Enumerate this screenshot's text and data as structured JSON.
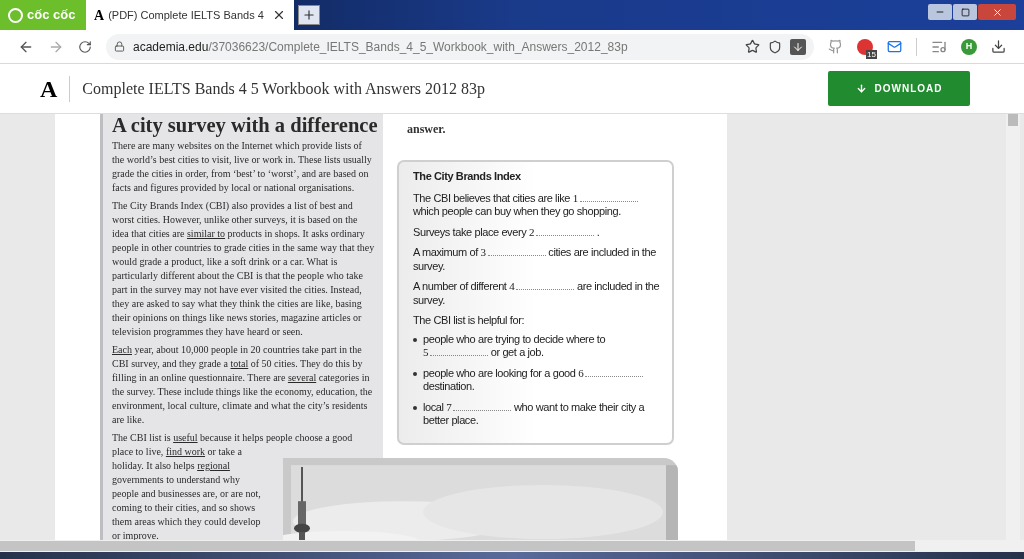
{
  "browser": {
    "brand": "cốc cốc",
    "tabs": [
      {
        "favicon": "A",
        "title": "(PDF) Complete IELTS Bands 4",
        "selected": true
      }
    ],
    "url_domain": "academia.edu",
    "url_path": "/37036623/Complete_IELTS_Bands_4_5_Workbook_with_Answers_2012_83p",
    "extension_badge": "15",
    "profile_initial": "H"
  },
  "header": {
    "logo": "A",
    "title": "Complete IELTS Bands 4 5 Workbook with Answers 2012 83p",
    "download": "DOWNLOAD"
  },
  "article": {
    "title": "A city survey with a difference",
    "paragraphs": [
      [
        {
          "text": "There are many websites on the Internet which provide lists of the world’s best cities to visit, live or work in. These lists usually grade the cities in order, from ‘best’ to ‘worst’, and are based on facts and figures provided by local or national organisations.",
          "underline": false
        }
      ],
      [
        {
          "text": "The City Brands Index (CBI) also provides a list of best and worst cities. However, unlike other surveys, it is based on the idea that cities are ",
          "underline": false
        },
        {
          "text": "similar to",
          "underline": true
        },
        {
          "text": " products in shops. It asks ordinary people in other countries to grade cities in the same way that they would grade a product, like a soft drink or a car. What is particularly different about the CBI is that the people who take part in the survey may not have ever visited the cities. Instead, they are asked to say what they think the cities are like, basing their opinions on things like news stories, magazine articles or television programmes they have heard or seen.",
          "underline": false
        }
      ],
      [
        {
          "text": "Each",
          "underline": true
        },
        {
          "text": " year, about 10,000 people in 20 countries take part in the CBI survey, and they grade a ",
          "underline": false
        },
        {
          "text": "total",
          "underline": true
        },
        {
          "text": " of 50 cities. They do this by filling in an online questionnaire. There are ",
          "underline": false
        },
        {
          "text": "several",
          "underline": true
        },
        {
          "text": " categories in the survey. These include things like the economy, education, the environment, local culture, climate and what the city’s residents are like.",
          "underline": false
        }
      ],
      [
        {
          "text": "The CBI list is ",
          "underline": false
        },
        {
          "text": "useful",
          "underline": true
        },
        {
          "text": " because it helps people choose a good place to live, ",
          "underline": false
        },
        {
          "text": "find work",
          "underline": true
        },
        {
          "text": " or take a holiday. It also helps ",
          "underline": false
        },
        {
          "text": "regional",
          "underline": true
        },
        {
          "text": " governments to understand why people and businesses are, or are not, coming to their cities, and so shows them areas which they could develop or improve.",
          "underline": false
        }
      ]
    ],
    "picture": {
      "kind": "picture"
    }
  },
  "task": {
    "instruction": "answer.",
    "box_title": "The City Brands Index",
    "items": [
      {
        "kind": "gap",
        "before": "The CBI believes that cities are like",
        "number": "1",
        "after": "which people can buy when they go shopping."
      },
      {
        "kind": "gap",
        "before": "Surveys take place every",
        "number": "2",
        "after": "."
      },
      {
        "kind": "gap",
        "before": "A maximum of",
        "number": "3",
        "after": "cities are included in the survey."
      },
      {
        "kind": "gap",
        "before": "A number of different",
        "number": "4",
        "after": "are included in the survey."
      },
      {
        "kind": "intro",
        "before": "The CBI list is helpful for:"
      },
      {
        "kind": "bullet",
        "before": "people who are trying to decide where to",
        "number": "5",
        "after": "or get a job."
      },
      {
        "kind": "bullet",
        "before": "people who are looking for a good",
        "number": "6",
        "after": "destination."
      },
      {
        "kind": "bullet",
        "before": "local",
        "number": "7",
        "after": "who want to make their city a better place."
      }
    ]
  }
}
